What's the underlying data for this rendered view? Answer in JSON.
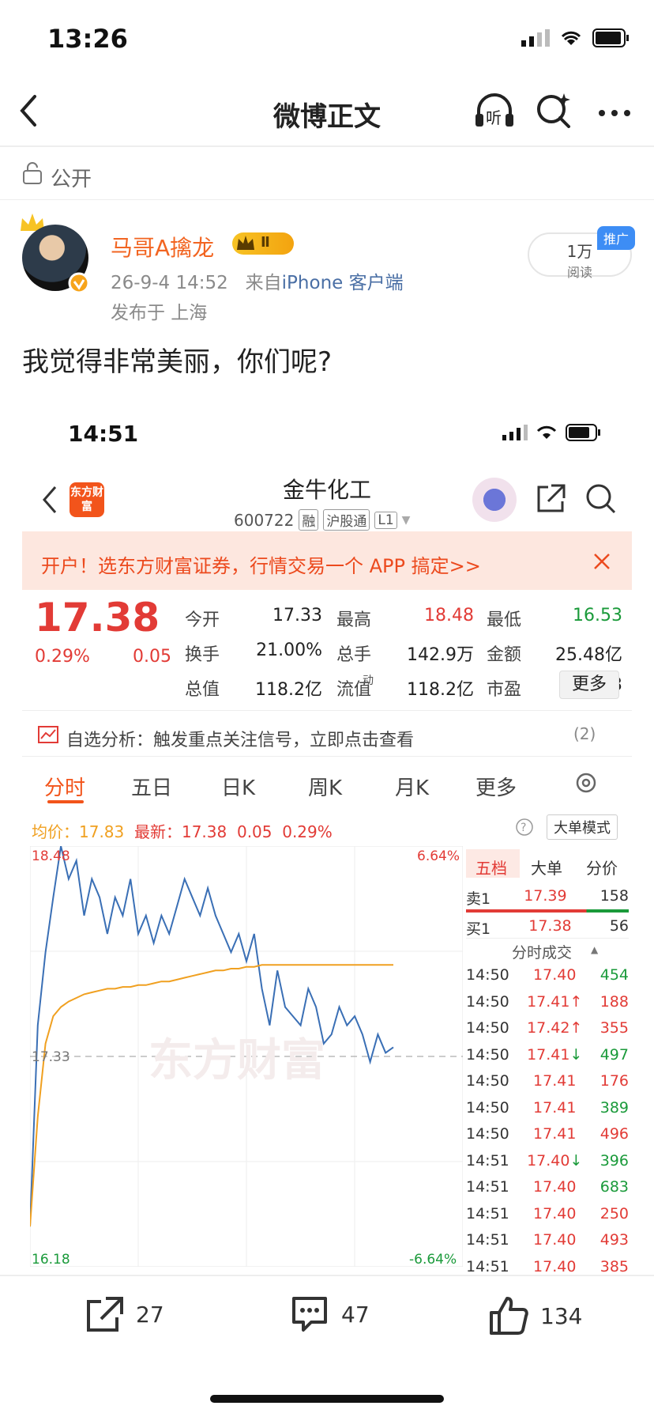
{
  "status": {
    "time": "13:26"
  },
  "nav": {
    "title": "微博正文"
  },
  "visibility": "公开",
  "author": {
    "name": "马哥A擒龙",
    "level_badge": "Ⅱ",
    "time": "26-9-4 14:52",
    "from_prefix": "来自",
    "client": "iPhone 客户端",
    "location": "发布于 上海"
  },
  "reads": {
    "count": "1万",
    "label": "阅读",
    "promo": "推广"
  },
  "post": {
    "text": "我觉得非常美丽，你们呢?"
  },
  "embedded": {
    "time": "14:51",
    "app_logo": "东方财富",
    "stock_name": "金牛化工",
    "stock_code": "600722",
    "tags": [
      "融",
      "沪股通",
      "L1"
    ],
    "banner": "开户！选东方财富证券，行情交易一个 APP 搞定>>",
    "price": "17.38",
    "change_pct": "0.29%",
    "change_amt": "0.05",
    "quotes": [
      {
        "label": "今开",
        "value": "17.33",
        "color": "#222222"
      },
      {
        "label": "最高",
        "value": "18.48",
        "color": "#e23b36"
      },
      {
        "label": "最低",
        "value": "16.53",
        "color": "#1a9a3a"
      },
      {
        "label": "换手",
        "value": "21.00%",
        "color": "#222222"
      },
      {
        "label": "总手",
        "value": "142.9万",
        "color": "#222222"
      },
      {
        "label": "金额",
        "value": "25.48亿",
        "color": "#222222"
      },
      {
        "label": "总值",
        "value": "118.2亿",
        "color": "#222222"
      },
      {
        "label": "流值",
        "value": "118.2亿",
        "color": "#222222"
      },
      {
        "label": "市盈",
        "value": "168.43",
        "color": "#222222"
      }
    ],
    "pe_superscript": "动",
    "more_label": "更多",
    "analysis_text": "自选分析：触发重点关注信号，立即点击查看",
    "analysis_count": "(2)",
    "tabs": [
      "分时",
      "五日",
      "日K",
      "周K",
      "月K",
      "更多"
    ],
    "avg_label": "均价：",
    "avg_value": "17.83",
    "latest_label": "最新：",
    "latest_price": "17.38",
    "latest_chg": "0.05",
    "latest_pct": "0.29%",
    "mode_button": "大单模式",
    "watermark": "东方财富",
    "axis": {
      "high": "18.48",
      "high_pct": "6.64%",
      "mid": "17.33",
      "low": "16.18",
      "low_pct": "-6.64%"
    },
    "panel_tabs": [
      "五档",
      "大单",
      "分价"
    ],
    "order_book": [
      {
        "label": "卖1",
        "price": "17.39",
        "volume": "158"
      },
      {
        "label": "买1",
        "price": "17.38",
        "volume": "56"
      }
    ],
    "trades_title": "分时成交",
    "trades": [
      {
        "time": "14:50",
        "price": "17.40",
        "arrow": "",
        "volume": "454",
        "vcolor": "#1a9a3a"
      },
      {
        "time": "14:50",
        "price": "17.41",
        "arrow": "↑",
        "volume": "188",
        "vcolor": "#e23b36"
      },
      {
        "time": "14:50",
        "price": "17.42",
        "arrow": "↑",
        "volume": "355",
        "vcolor": "#e23b36"
      },
      {
        "time": "14:50",
        "price": "17.41",
        "arrow": "↓",
        "volume": "497",
        "vcolor": "#1a9a3a"
      },
      {
        "time": "14:50",
        "price": "17.41",
        "arrow": "",
        "volume": "176",
        "vcolor": "#e23b36"
      },
      {
        "time": "14:50",
        "price": "17.41",
        "arrow": "",
        "volume": "389",
        "vcolor": "#1a9a3a"
      },
      {
        "time": "14:50",
        "price": "17.41",
        "arrow": "",
        "volume": "496",
        "vcolor": "#e23b36"
      },
      {
        "time": "14:51",
        "price": "17.40",
        "arrow": "↓",
        "volume": "396",
        "vcolor": "#1a9a3a"
      },
      {
        "time": "14:51",
        "price": "17.40",
        "arrow": "",
        "volume": "683",
        "vcolor": "#1a9a3a"
      },
      {
        "time": "14:51",
        "price": "17.40",
        "arrow": "",
        "volume": "250",
        "vcolor": "#e23b36"
      },
      {
        "time": "14:51",
        "price": "17.40",
        "arrow": "",
        "volume": "493",
        "vcolor": "#e23b36"
      },
      {
        "time": "14:51",
        "price": "17.40",
        "arrow": "",
        "volume": "385",
        "vcolor": "#e23b36"
      }
    ]
  },
  "chart_data": {
    "type": "line",
    "ylim": [
      16.18,
      18.48
    ],
    "series": [
      {
        "values": [
          16.4,
          17.5,
          17.9,
          18.2,
          18.48,
          18.3,
          18.4,
          18.1,
          18.3,
          18.2,
          18.0,
          18.2,
          18.1,
          18.3,
          18.0,
          18.1,
          17.95,
          18.1,
          18.0,
          18.15,
          18.3,
          18.2,
          18.1,
          18.25,
          18.1,
          18.0,
          17.9,
          18.0,
          17.85,
          18.0,
          17.7,
          17.5,
          17.8,
          17.6,
          17.55,
          17.5,
          17.7,
          17.6,
          17.4,
          17.45,
          17.6,
          17.5,
          17.55,
          17.45,
          17.3,
          17.45,
          17.35,
          17.38
        ]
      },
      {
        "values": [
          16.4,
          17.0,
          17.4,
          17.55,
          17.6,
          17.63,
          17.65,
          17.67,
          17.68,
          17.69,
          17.7,
          17.7,
          17.71,
          17.71,
          17.72,
          17.72,
          17.73,
          17.74,
          17.74,
          17.75,
          17.76,
          17.77,
          17.78,
          17.79,
          17.8,
          17.8,
          17.81,
          17.81,
          17.82,
          17.82,
          17.83,
          17.83,
          17.83,
          17.83,
          17.83,
          17.83,
          17.83,
          17.83,
          17.83,
          17.83,
          17.83,
          17.83,
          17.83,
          17.83,
          17.83,
          17.83,
          17.83,
          17.83
        ]
      }
    ]
  }
}
